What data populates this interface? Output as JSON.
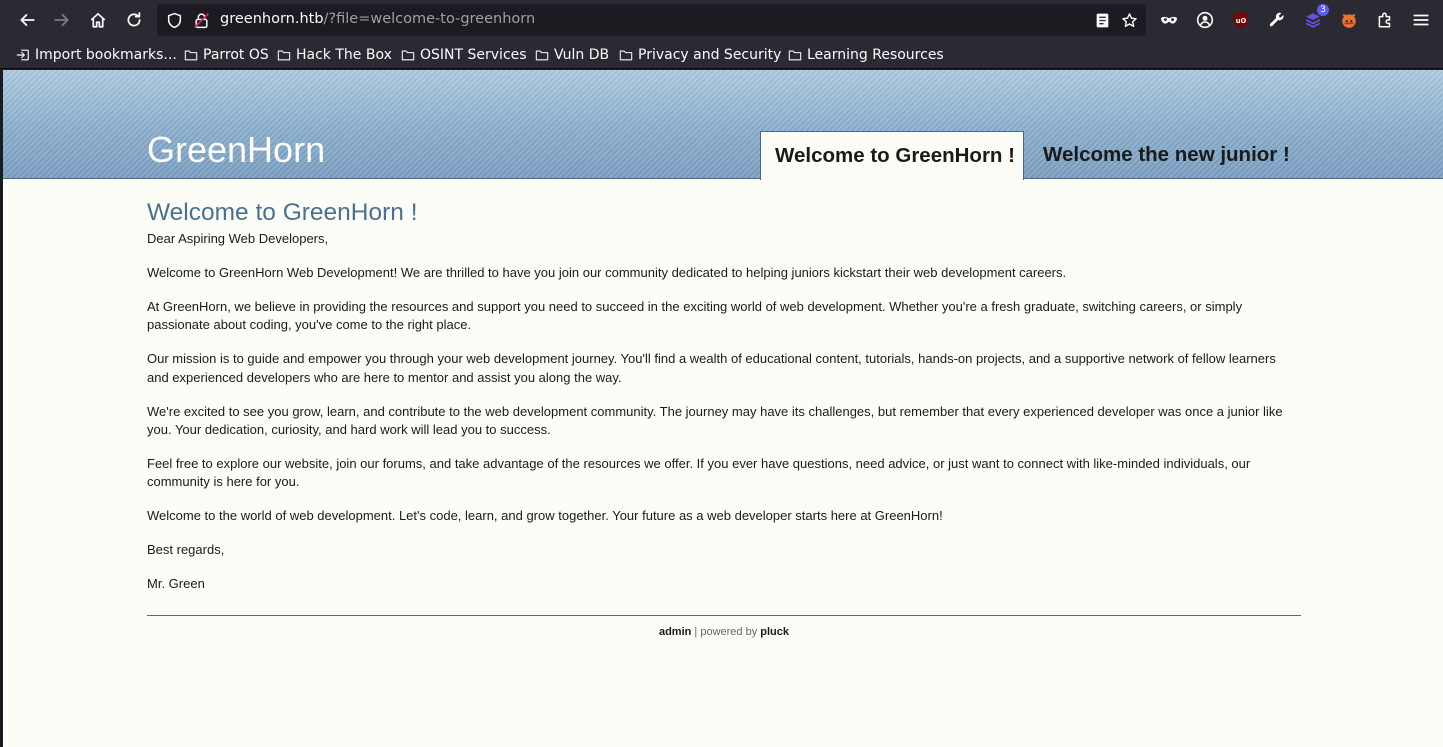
{
  "browser": {
    "url_host": "greenhorn.htb",
    "url_path": "/?file=welcome-to-greenhorn",
    "extension_badge": "3",
    "bookmarks": [
      "Import bookmarks...",
      "Parrot OS",
      "Hack The Box",
      "OSINT Services",
      "Vuln DB",
      "Privacy and Security",
      "Learning Resources"
    ]
  },
  "site": {
    "title": "GreenHorn",
    "tabs": [
      "Welcome to GreenHorn !",
      "Welcome the new junior !"
    ]
  },
  "article": {
    "heading": "Welcome to GreenHorn !",
    "paragraphs": [
      "Dear Aspiring Web Developers,",
      "Welcome to GreenHorn Web Development! We are thrilled to have you join our community dedicated to helping juniors kickstart their web development careers.",
      "At GreenHorn, we believe in providing the resources and support you need to succeed in the exciting world of web development. Whether you're a fresh graduate, switching careers, or simply passionate about coding, you've come to the right place.",
      "Our mission is to guide and empower you through your web development journey. You'll find a wealth of educational content, tutorials, hands-on projects, and a supportive network of fellow learners and experienced developers who are here to mentor and assist you along the way.",
      "We're excited to see you grow, learn, and contribute to the web development community. The journey may have its challenges, but remember that every experienced developer was once a junior like you. Your dedication, curiosity, and hard work will lead you to success.",
      "Feel free to explore our website, join our forums, and take advantage of the resources we offer. If you ever have questions, need advice, or just want to connect with like-minded individuals, our community is here for you.",
      "Welcome to the world of web development. Let's code, learn, and grow together. Your future as a web developer starts here at GreenHorn!",
      "Best regards,",
      "Mr. Green"
    ]
  },
  "footer": {
    "admin_link": "admin",
    "separator": " | powered by ",
    "pluck_link": "pluck"
  }
}
